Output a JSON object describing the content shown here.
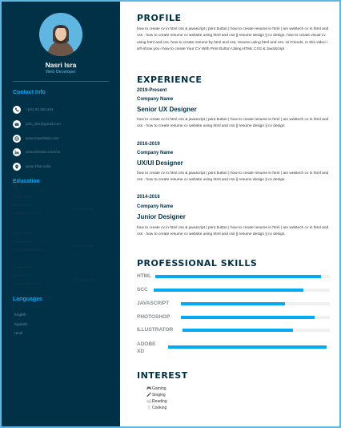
{
  "profile_card": {
    "name": "Nasri Isra",
    "role": "Web Developer"
  },
  "contact": {
    "title": "Contact Info",
    "items": [
      {
        "icon": "phone-icon",
        "text": "+(91) 92 255 693"
      },
      {
        "icon": "email-icon",
        "text": "john_doe@gmail.com"
      },
      {
        "icon": "globe-icon",
        "text": "www.mywebsite.com"
      },
      {
        "icon": "linkedin-icon",
        "text": "www.linkedin.com/me"
      },
      {
        "icon": "location-icon",
        "text": "jaimp bhar,india"
      }
    ]
  },
  "education": {
    "title": "Education",
    "lines": [
      "2010 - 2013",
      "Matriculation",
      "Lorem ipsum dolor",
      "Lorem ipsum",
      "2013 - 2015",
      "Intermediate",
      "Lorem ipsum dolor",
      "Lorem ipsum",
      "2015 - 2019",
      "Graduation",
      "Lorem ipsum dolor",
      "Lorem ipsum"
    ]
  },
  "languages": {
    "title": "Languages",
    "items": [
      "English",
      "Spanish",
      "Hindi"
    ]
  },
  "profile": {
    "title": "PROFILE",
    "text": "how to create cv in html css & javascript | print button | how to create resume in html | am webtech cv in html and css · how to create resume cv website using html and css || resume design || cv design. how to create visual cv using html and css. how to create resume by html and css, resume using html and css. Hi Friends, In this video i w'll show you i how to create Your CV With Print Button Using HTML CSS & JavaScript"
  },
  "experience": {
    "title": "EXPERIENCE",
    "items": [
      {
        "years": "2019-Present",
        "company": "Company Name",
        "role": "Senior UX Designer",
        "desc": "how to create cv in html css & javascript | print button | how to create resume in html | am webtech cv in html and css · how to create resume cv website using html and css || resume design || cv design."
      },
      {
        "years": "2016-2019",
        "company": "Company Name",
        "role": "UX/UI Designer",
        "desc": "how to create cv in html css & javascript | print button | how to create resume in html | am webtech cv in html and css · how to create resume cv website using html and css || resume design || cv design."
      },
      {
        "years": "2014-2016",
        "company": "Company Name",
        "role": "Junior Designer",
        "desc": "how to create cv in html css & javascript | print button | how to create resume in html | am webtech cv in html and css · how to create resume cv website using html and css || resume design || cv design."
      }
    ]
  },
  "skills": {
    "title": "PROFESSIONAL SKILLS",
    "items": [
      {
        "name": "HTML",
        "level": 0.95
      },
      {
        "name": "SCC",
        "level": 0.85
      },
      {
        "name": "JAVASCRIPT",
        "level": 0.7
      },
      {
        "name": "PHOTOSHOP",
        "level": 0.9
      },
      {
        "name": "ILLUSTRATOR",
        "level": 0.75
      },
      {
        "name": "ADOBE XD",
        "level": 0.98
      }
    ]
  },
  "interest": {
    "title": "INTEREST",
    "items": [
      {
        "icon": "gamepad-icon",
        "text": "Gaming"
      },
      {
        "icon": "microphone-icon",
        "text": "Singing"
      },
      {
        "icon": "book-icon",
        "text": "Reading"
      },
      {
        "icon": "utensils-icon",
        "text": "Cooking"
      }
    ]
  },
  "colors": {
    "sidebar": "#003147",
    "accent": "#03a9f4",
    "border": "#5fb6e0"
  }
}
